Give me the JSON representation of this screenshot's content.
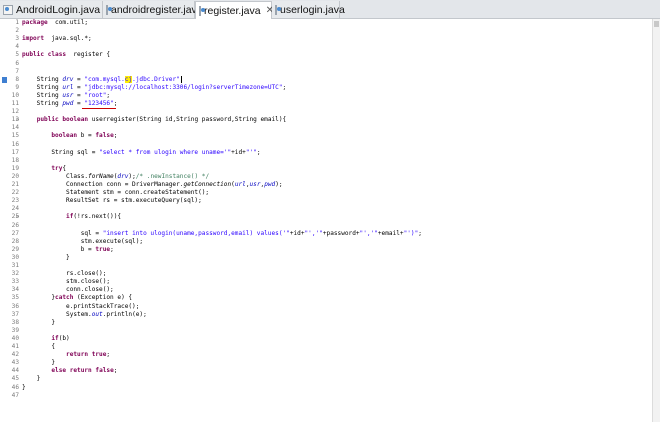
{
  "tabs": [
    {
      "label": "AndroidLogin.java",
      "active": false
    },
    {
      "label": "androidregister.java",
      "active": false
    },
    {
      "label": "register.java",
      "active": true,
      "close": "✕"
    },
    {
      "label": "userlogin.java",
      "active": false
    }
  ],
  "lines": [
    {
      "n": "1",
      "s": [
        [
          "kw",
          "package"
        ],
        [
          "",
          "  com.util;"
        ]
      ]
    },
    {
      "n": "2",
      "s": []
    },
    {
      "n": "3",
      "s": [
        [
          "kw",
          "import"
        ],
        [
          "",
          "  java.sql.*;"
        ]
      ]
    },
    {
      "n": "4",
      "s": []
    },
    {
      "n": "5",
      "s": [
        [
          "kw",
          "public"
        ],
        [
          "",
          " "
        ],
        [
          "kw",
          "class"
        ],
        [
          "",
          "  register {"
        ]
      ]
    },
    {
      "n": "6",
      "s": []
    },
    {
      "n": "7",
      "s": []
    },
    {
      "n": "8",
      "s": [
        [
          "",
          "    String "
        ],
        [
          "fld",
          "drv"
        ],
        [
          "",
          " = "
        ],
        [
          "str",
          "\"com.mysql."
        ],
        [
          "hlstr",
          "cj"
        ],
        [
          "str",
          ".jdbc.Driver\""
        ],
        [
          "",
          ";"
        ]
      ]
    },
    {
      "n": "9",
      "s": [
        [
          "",
          "    String "
        ],
        [
          "fld",
          "url"
        ],
        [
          "",
          " = "
        ],
        [
          "str",
          "\"jdbc:mysql://localhost:3306/login?serverTimezone=UTC\""
        ],
        [
          "",
          ";"
        ]
      ]
    },
    {
      "n": "10",
      "s": [
        [
          "",
          "    String "
        ],
        [
          "fld",
          "usr"
        ],
        [
          "",
          " = "
        ],
        [
          "str",
          "\"root\""
        ],
        [
          "",
          ";"
        ]
      ]
    },
    {
      "n": "11",
      "s": [
        [
          "",
          "    String "
        ],
        [
          "fld",
          "pwd"
        ],
        [
          "",
          " = "
        ],
        [
          "str",
          "\"123456\""
        ],
        [
          "",
          ";"
        ]
      ]
    },
    {
      "n": "12",
      "s": []
    },
    {
      "n": "13",
      "s": [
        [
          "",
          "    "
        ],
        [
          "kw",
          "public"
        ],
        [
          "",
          " "
        ],
        [
          "kw",
          "boolean"
        ],
        [
          "",
          " userregister(String id,String password,String email){"
        ]
      ]
    },
    {
      "n": "14",
      "s": []
    },
    {
      "n": "15",
      "s": [
        [
          "",
          "        "
        ],
        [
          "kw",
          "boolean"
        ],
        [
          "",
          " b = "
        ],
        [
          "kw",
          "false"
        ],
        [
          "",
          ";"
        ]
      ]
    },
    {
      "n": "16",
      "s": []
    },
    {
      "n": "17",
      "s": [
        [
          "",
          "        String sql = "
        ],
        [
          "str",
          "\"select * from ulogin where uname='\""
        ],
        [
          "",
          "+id+"
        ],
        [
          "str",
          "\"'\""
        ],
        [
          "",
          ";"
        ]
      ]
    },
    {
      "n": "18",
      "s": []
    },
    {
      "n": "19",
      "s": [
        [
          "",
          "        "
        ],
        [
          "kw",
          "try"
        ],
        [
          "",
          "{"
        ]
      ]
    },
    {
      "n": "20",
      "s": [
        [
          "",
          "            Class."
        ],
        [
          "it",
          "forName"
        ],
        [
          "",
          "("
        ],
        [
          "fld",
          "drv"
        ],
        [
          "",
          ");"
        ],
        [
          "cm",
          "/* .newInstance() */"
        ]
      ]
    },
    {
      "n": "21",
      "s": [
        [
          "",
          "            Connection conn = DriverManager."
        ],
        [
          "it",
          "getConnection"
        ],
        [
          "",
          "("
        ],
        [
          "fld",
          "url"
        ],
        [
          "",
          ","
        ],
        [
          "fld",
          "usr"
        ],
        [
          "",
          ","
        ],
        [
          "fld",
          "pwd"
        ],
        [
          "",
          ");"
        ]
      ]
    },
    {
      "n": "22",
      "s": [
        [
          "",
          "            Statement stm = conn.createStatement();"
        ]
      ]
    },
    {
      "n": "23",
      "s": [
        [
          "",
          "            ResultSet rs = stm.executeQuery(sql);"
        ]
      ]
    },
    {
      "n": "24",
      "s": []
    },
    {
      "n": "25",
      "s": [
        [
          "",
          "            "
        ],
        [
          "kw",
          "if"
        ],
        [
          "",
          "(!rs.next()){"
        ]
      ]
    },
    {
      "n": "26",
      "s": []
    },
    {
      "n": "27",
      "s": [
        [
          "",
          "                sql = "
        ],
        [
          "str",
          "\"insert into ulogin(uname,password,email) values('\""
        ],
        [
          "",
          "+id+"
        ],
        [
          "str",
          "\"','\""
        ],
        [
          "",
          "+password+"
        ],
        [
          "str",
          "\"','\""
        ],
        [
          "",
          "+email+"
        ],
        [
          "str",
          "\"')\""
        ],
        [
          "",
          ";"
        ]
      ]
    },
    {
      "n": "28",
      "s": [
        [
          "",
          "                stm.execute(sql);"
        ]
      ]
    },
    {
      "n": "29",
      "s": [
        [
          "",
          "                b = "
        ],
        [
          "kw",
          "true"
        ],
        [
          "",
          ";"
        ]
      ]
    },
    {
      "n": "30",
      "s": [
        [
          "",
          "            }"
        ]
      ]
    },
    {
      "n": "31",
      "s": []
    },
    {
      "n": "32",
      "s": [
        [
          "",
          "            rs.close();"
        ]
      ]
    },
    {
      "n": "33",
      "s": [
        [
          "",
          "            stm.close();"
        ]
      ]
    },
    {
      "n": "34",
      "s": [
        [
          "",
          "            conn.close();"
        ]
      ]
    },
    {
      "n": "35",
      "s": [
        [
          "",
          "        }"
        ],
        [
          "kw",
          "catch"
        ],
        [
          "",
          " (Exception e) {"
        ]
      ]
    },
    {
      "n": "36",
      "s": [
        [
          "",
          "            e.printStackTrace();"
        ]
      ]
    },
    {
      "n": "37",
      "s": [
        [
          "",
          "            System."
        ],
        [
          "fld",
          "out"
        ],
        [
          "",
          ".println(e);"
        ]
      ]
    },
    {
      "n": "38",
      "s": [
        [
          "",
          "        }"
        ]
      ]
    },
    {
      "n": "39",
      "s": []
    },
    {
      "n": "40",
      "s": [
        [
          "",
          "        "
        ],
        [
          "kw",
          "if"
        ],
        [
          "",
          "(b)"
        ]
      ]
    },
    {
      "n": "41",
      "s": [
        [
          "",
          "        {"
        ]
      ]
    },
    {
      "n": "42",
      "s": [
        [
          "",
          "            "
        ],
        [
          "kw",
          "return"
        ],
        [
          "",
          " "
        ],
        [
          "kw",
          "true"
        ],
        [
          "",
          ";"
        ]
      ]
    },
    {
      "n": "43",
      "s": [
        [
          "",
          "        }"
        ]
      ]
    },
    {
      "n": "44",
      "s": [
        [
          "",
          "        "
        ],
        [
          "kw",
          "else"
        ],
        [
          "",
          " "
        ],
        [
          "kw",
          "return"
        ],
        [
          "",
          " "
        ],
        [
          "kw",
          "false"
        ],
        [
          "",
          ";"
        ]
      ]
    },
    {
      "n": "45",
      "s": [
        [
          "",
          "    }"
        ]
      ]
    },
    {
      "n": "46",
      "s": [
        [
          "",
          "}"
        ]
      ]
    },
    {
      "n": "47",
      "s": []
    }
  ]
}
